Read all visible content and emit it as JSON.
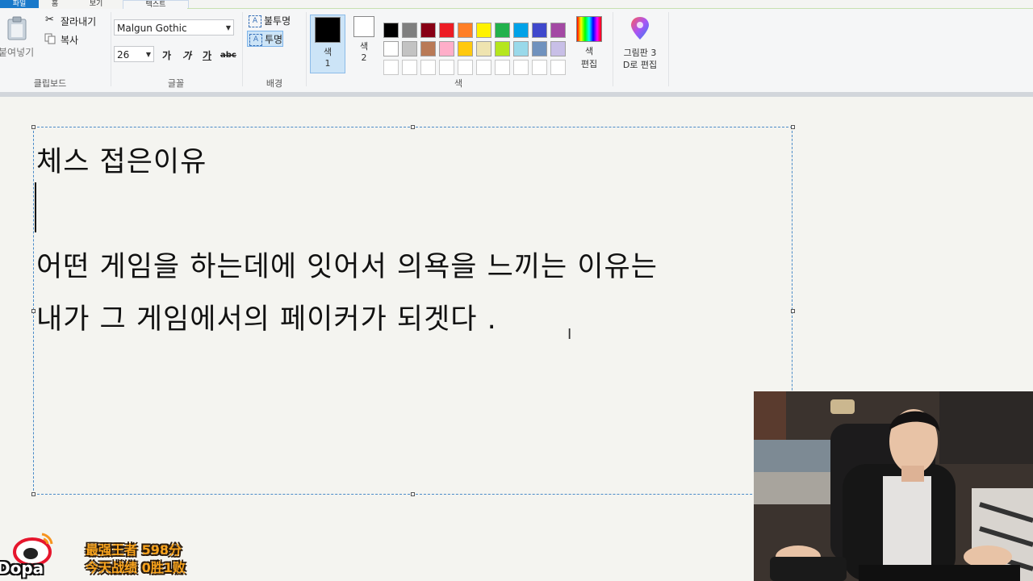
{
  "ribbon": {
    "tabs": [
      "파일",
      "홈",
      "보기",
      "텍스트"
    ],
    "clipboard": {
      "paste_label": "붙여넣기",
      "cut_label": "잘라내기",
      "copy_label": "복사",
      "group_label": "클립보드"
    },
    "font": {
      "family_value": "Malgun Gothic",
      "size_value": "26",
      "bold_label": "가",
      "italic_label": "가",
      "underline_label": "가",
      "strike_label": "abc",
      "group_label": "글꼴"
    },
    "background": {
      "opaque_label": "불투명",
      "transparent_label": "투명",
      "icon_glyph": "A",
      "group_label": "배경"
    },
    "colors": {
      "color1_label": "색",
      "color1_num": "1",
      "color1_value": "#000000",
      "color2_label": "색",
      "color2_num": "2",
      "color2_value": "#ffffff",
      "palette": [
        [
          "#000000",
          "#7f7f7f",
          "#880015",
          "#ed1c24",
          "#ff7f27",
          "#fff200",
          "#22b14c",
          "#00a2e8",
          "#3f48cc",
          "#a349a4"
        ],
        [
          "#ffffff",
          "#c3c3c3",
          "#b97a57",
          "#ffaec9",
          "#ffc90e",
          "#efe4b0",
          "#b5e61d",
          "#99d9ea",
          "#7092be",
          "#c8bfe7"
        ],
        [
          "#ffffff",
          "#ffffff",
          "#ffffff",
          "#ffffff",
          "#ffffff",
          "#ffffff",
          "#ffffff",
          "#ffffff",
          "#ffffff",
          "#ffffff"
        ]
      ],
      "edit_label_1": "색",
      "edit_label_2": "편집",
      "group_label": "색"
    },
    "paint3d": {
      "label_line1": "그림판 3",
      "label_line2": "D로 편집"
    }
  },
  "canvas": {
    "lines": [
      "체스 접은이유",
      "어떤 게임을 하는데에 잇어서 의욕을 느끼는 이유는",
      "내가 그 게임에서의 페이커가 되겟다 ."
    ],
    "cursor_glyph": "I"
  },
  "overlay": {
    "weibo_text": "Dopa",
    "stat_line1": "最强王者 598分",
    "stat_line2": "今天战绩 0胜1败"
  }
}
